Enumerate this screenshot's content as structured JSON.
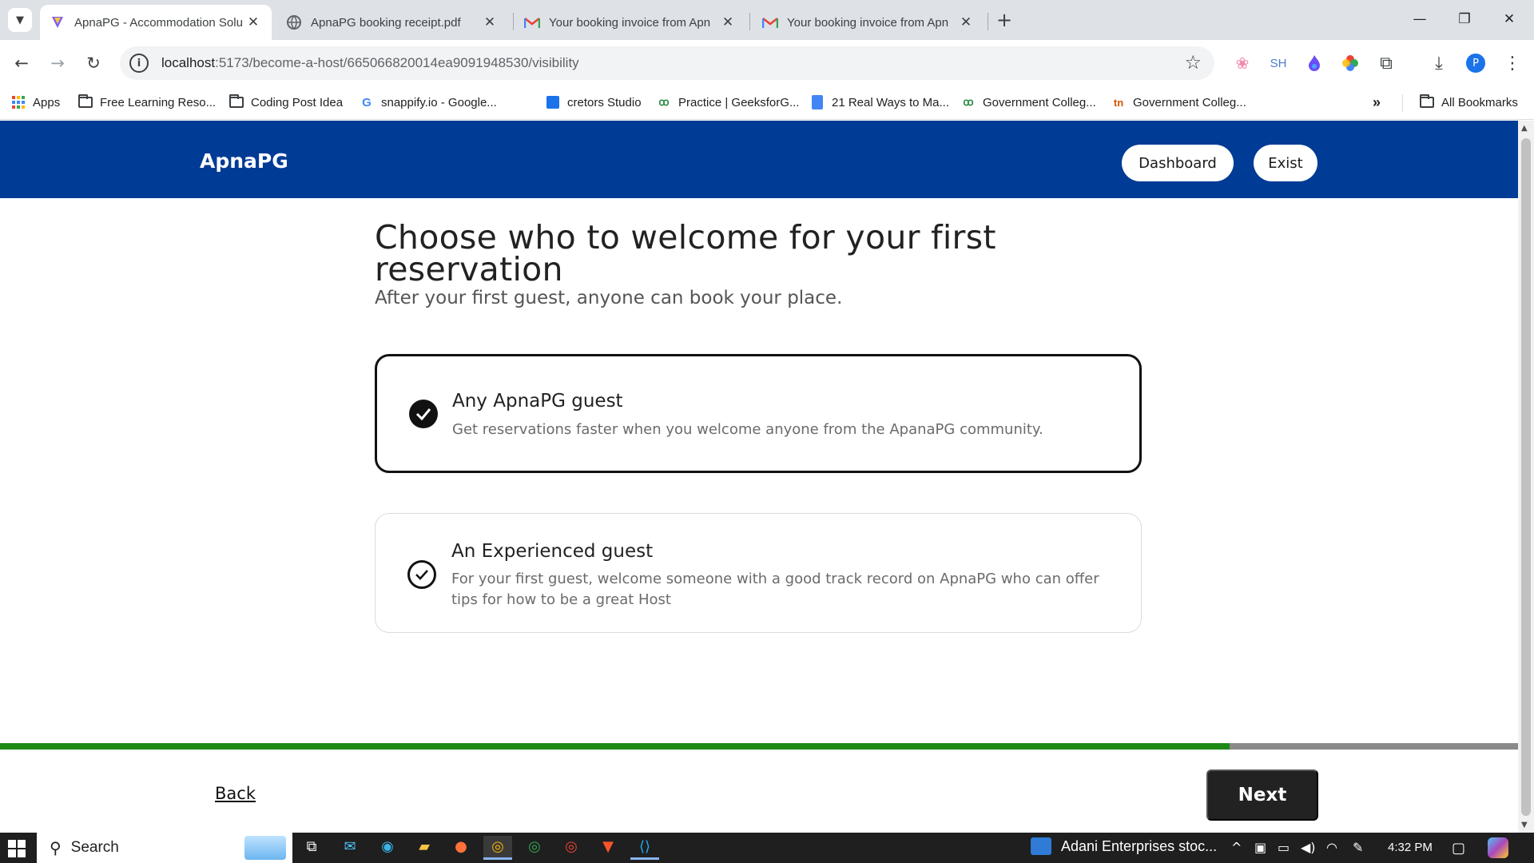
{
  "browser": {
    "tabs": [
      {
        "title": "ApnaPG - Accommodation Solu",
        "active": true,
        "icon": "apnapg-favicon-icon"
      },
      {
        "title": "ApnaPG booking receipt.pdf",
        "active": false,
        "icon": "globe-icon"
      },
      {
        "title": "Your booking invoice from Apn",
        "active": false,
        "icon": "gmail-icon"
      },
      {
        "title": "Your booking invoice from Apn",
        "active": false,
        "icon": "gmail-icon"
      }
    ],
    "url_host": "localhost",
    "url_rest": ":5173/become-a-host/665066820014ea9091948530/visibility",
    "ext_sh": "SH",
    "profile_initial": "P",
    "bookmarks": [
      {
        "label": "Apps",
        "icon": "apps-grid-icon"
      },
      {
        "label": "Free Learning Reso...",
        "icon": "folder-icon"
      },
      {
        "label": "Coding Post Idea",
        "icon": "folder-icon"
      },
      {
        "label": "snappify.io - Google...",
        "icon": "google-icon"
      },
      {
        "label": "cretors Studio",
        "icon": "calendar-icon"
      },
      {
        "label": "Practice | GeeksforG...",
        "icon": "gfg-icon"
      },
      {
        "label": "21 Real Ways to Ma...",
        "icon": "docs-icon"
      },
      {
        "label": "Government Colleg...",
        "icon": "gfg-icon"
      },
      {
        "label": "Government Colleg...",
        "icon": "tn-icon"
      }
    ],
    "more_bookmarks": "»",
    "all_bookmarks": "All Bookmarks"
  },
  "page": {
    "logo": "ApnaPG",
    "header_buttons": {
      "dashboard": "Dashboard",
      "exit": "Exist"
    },
    "title": "Choose who to welcome for your first reservation",
    "subtitle": "After your first guest, anyone can book your place.",
    "options": [
      {
        "title": "Any ApnaPG guest",
        "description": "Get reservations faster when you welcome anyone from the ApanaPG community.",
        "selected": true
      },
      {
        "title": "An Experienced guest",
        "description": "For your first guest, welcome someone with a good track record on ApnaPG who can offer tips for how to be a great Host",
        "selected": false
      }
    ],
    "progress": 0.81,
    "back_label": "Back",
    "next_label": "Next"
  },
  "taskbar": {
    "search_label": "Search",
    "news": "Adani Enterprises stoc...",
    "time": "4:32 PM"
  },
  "colors": {
    "header_bg": "#003b95",
    "progress_fill": "#1e8a16",
    "progress_track": "#8a8a8a"
  }
}
